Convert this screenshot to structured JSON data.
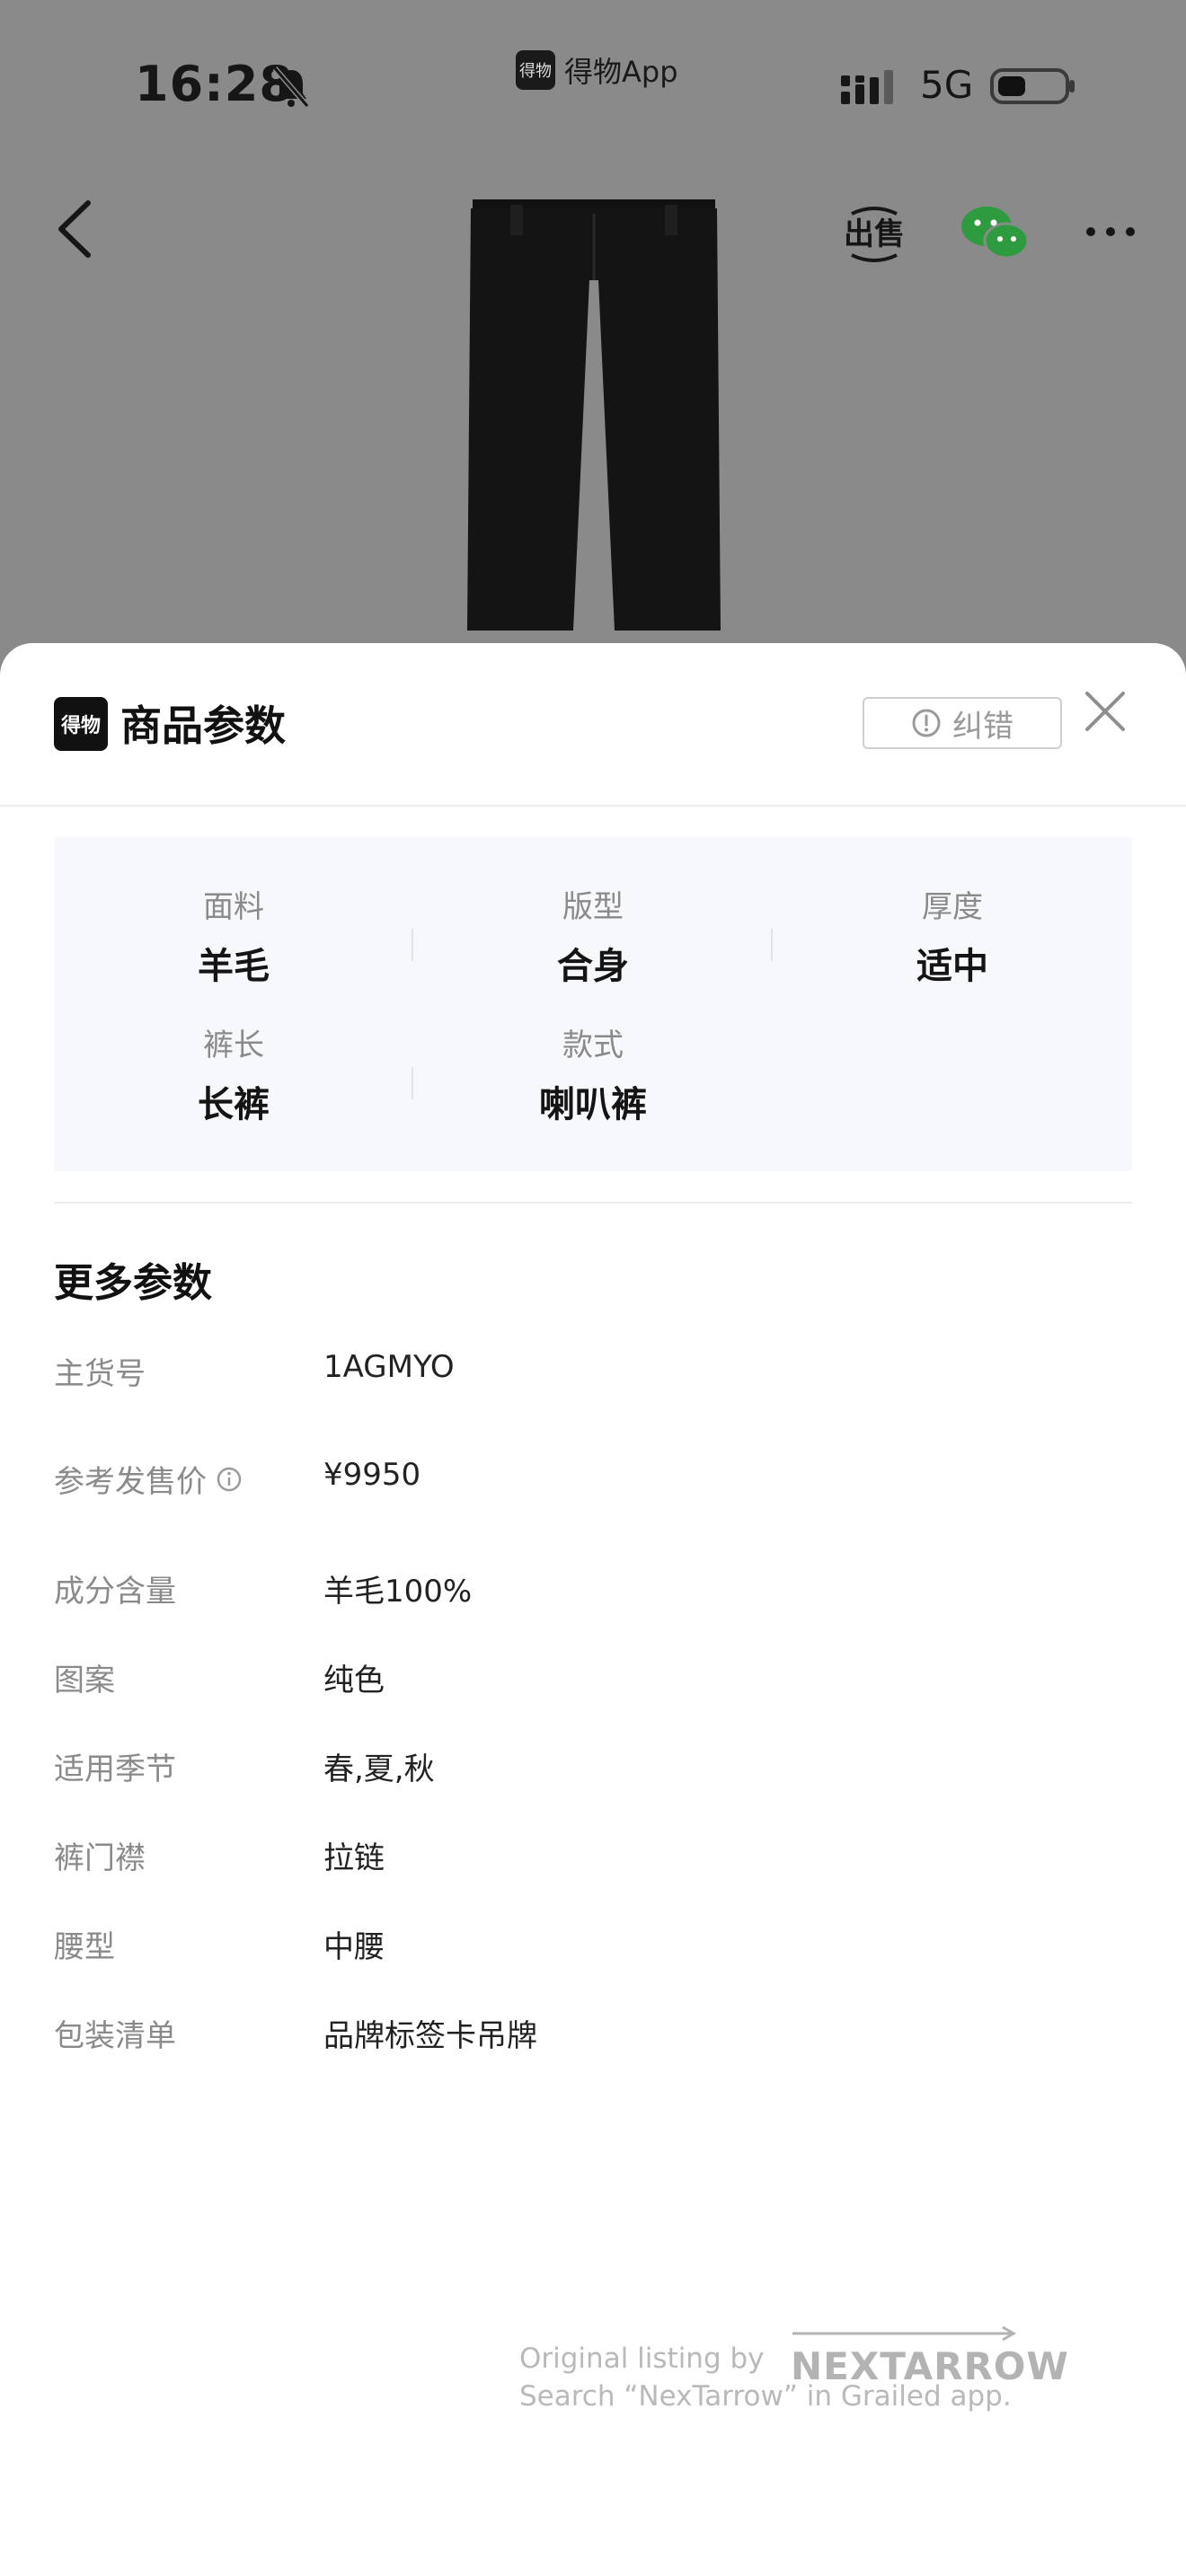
{
  "status_bar": {
    "time": "16:28",
    "app_name": "得物App",
    "app_logo_text": "得物",
    "network": "5G"
  },
  "sheet": {
    "logo_text": "得物",
    "title": "商品参数",
    "report_label": "纠错"
  },
  "key_params": [
    {
      "label": "面料",
      "value": "羊毛"
    },
    {
      "label": "版型",
      "value": "合身"
    },
    {
      "label": "厚度",
      "value": "适中"
    },
    {
      "label": "裤长",
      "value": "长裤"
    },
    {
      "label": "款式",
      "value": "喇叭裤"
    }
  ],
  "more_params": {
    "title": "更多参数",
    "rows": [
      {
        "key": "主货号",
        "value": "1AGMYO"
      },
      {
        "key": "参考发售价",
        "value": "¥9950"
      },
      {
        "key": "成分含量",
        "value": "羊毛100%"
      },
      {
        "key": "图案",
        "value": "纯色"
      },
      {
        "key": "适用季节",
        "value": "春,夏,秋"
      },
      {
        "key": "裤门襟",
        "value": "拉链"
      },
      {
        "key": "腰型",
        "value": "中腰"
      },
      {
        "key": "包装清单",
        "value": "品牌标签卡吊牌"
      }
    ]
  },
  "watermark": {
    "line1": "Original listing by",
    "brand": "NEXTARROW",
    "line2": "Search “NexTarrow” in Grailed app."
  },
  "colors": {
    "overlay": "#8a8a8a",
    "card_bg": "#f7f8fb",
    "label_gray": "#8a8a8a"
  }
}
